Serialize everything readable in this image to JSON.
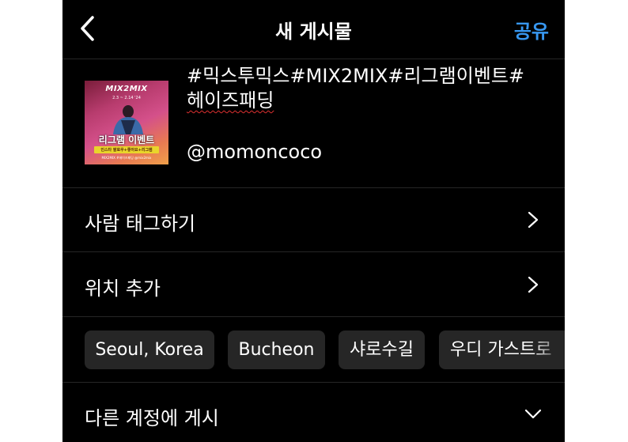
{
  "header": {
    "title": "새 게시물",
    "share_label": "공유"
  },
  "colors": {
    "accent": "#3797f0",
    "background": "#000000",
    "chip_bg": "#262626",
    "divider": "#262626"
  },
  "post": {
    "caption_line1": "#믹스투믹스#MIX2MIX#리그램이벤트#",
    "caption_line2": "헤이즈패딩",
    "mention": "@momoncoco",
    "thumbnail": {
      "title": "MIX2MIX",
      "date": "2.3 ~ 2.14 '24",
      "event_text": "리그램 이벤트",
      "band_text": "인스타 팔로우+좋아요+리그램",
      "footer": "MIX2MIX  #헤이즈패딩  @mix2mix"
    }
  },
  "rows": [
    {
      "label": "사람 태그하기",
      "icon": "chevron-right-icon"
    },
    {
      "label": "위치 추가",
      "icon": "chevron-right-icon"
    }
  ],
  "location_chips": [
    "Seoul, Korea",
    "Bucheon",
    "샤로수길",
    "우디 가스트로"
  ],
  "crosspost": {
    "label": "다른 계정에 게시",
    "icon": "chevron-down-icon"
  }
}
